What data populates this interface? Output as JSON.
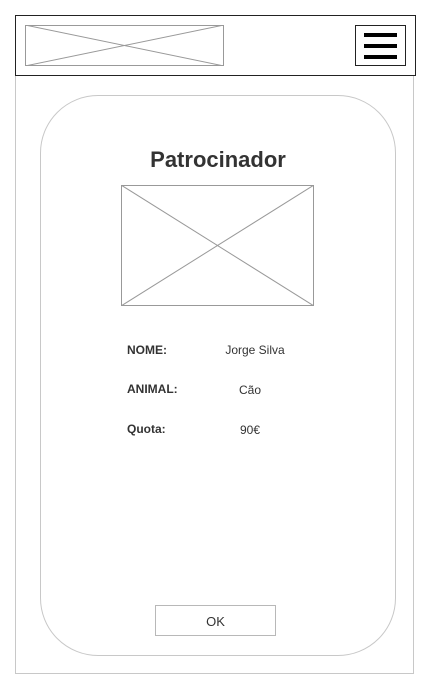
{
  "header": {
    "logo_icon": "image-placeholder-icon",
    "menu_icon": "hamburger-menu-icon"
  },
  "sponsor_card": {
    "title": "Patrocinador",
    "image_icon": "image-placeholder-icon",
    "fields": [
      {
        "label": "NOME:",
        "value": "Jorge Silva"
      },
      {
        "label": "ANIMAL:",
        "value": "Cão"
      },
      {
        "label": "Quota:",
        "value": "90€"
      }
    ],
    "ok_label": "OK"
  }
}
